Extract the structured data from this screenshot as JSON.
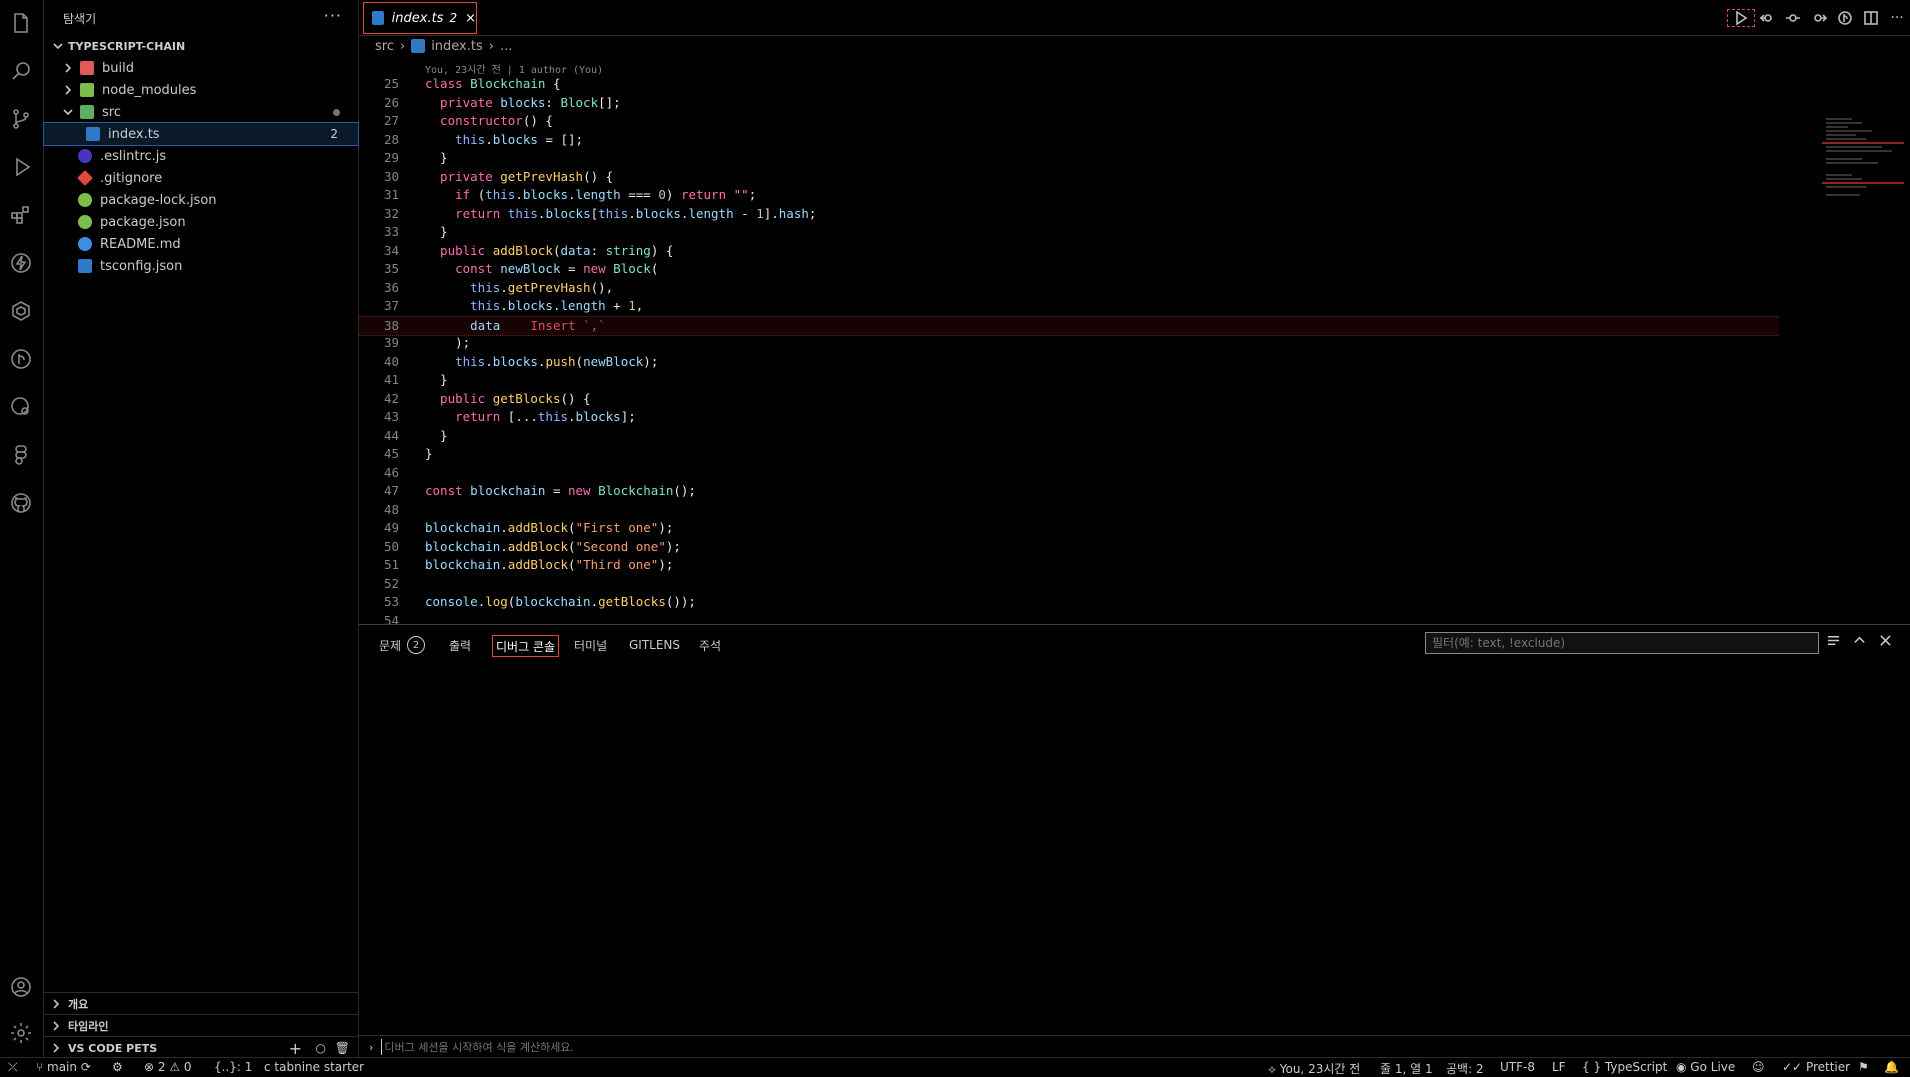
{
  "sidebar": {
    "title": "탐색기",
    "more": "···",
    "project": "TYPESCRIPT-CHAIN",
    "items": [
      {
        "label": "build",
        "type": "folder",
        "icon": "folder-build-icon",
        "color": "#e05a5a"
      },
      {
        "label": "node_modules",
        "type": "folder",
        "icon": "folder-node-icon",
        "color": "#7bbf4a"
      },
      {
        "label": "src",
        "type": "folder-open",
        "icon": "folder-src-icon",
        "color": "#5fae5f"
      },
      {
        "label": "index.ts",
        "type": "file",
        "icon": "typescript-file-icon",
        "color": "#3178c6",
        "badge": "2"
      },
      {
        "label": ".eslintrc.js",
        "type": "file",
        "icon": "eslint-icon",
        "color": "#4b32c3"
      },
      {
        "label": ".gitignore",
        "type": "file",
        "icon": "git-icon",
        "color": "#e0483a"
      },
      {
        "label": "package-lock.json",
        "type": "file",
        "icon": "npm-icon",
        "color": "#7bbf4a"
      },
      {
        "label": "package.json",
        "type": "file",
        "icon": "npm-icon",
        "color": "#7bbf4a"
      },
      {
        "label": "README.md",
        "type": "file",
        "icon": "info-icon",
        "color": "#3b8fe0"
      },
      {
        "label": "tsconfig.json",
        "type": "file",
        "icon": "tsconfig-icon",
        "color": "#3178c6"
      }
    ],
    "sections": [
      "개요",
      "타임라인",
      "VS CODE PETS"
    ]
  },
  "tab": {
    "label": "index.ts",
    "badge": "2",
    "close": "×"
  },
  "breadcrumb": {
    "folder": "src",
    "file": "index.ts",
    "more": "..."
  },
  "blame": "You, 23시간 전 | 1 author (You)",
  "panel": {
    "tabs": [
      "문제",
      "출력",
      "디버그 콘솔",
      "터미널",
      "GITLENS",
      "주석"
    ],
    "problems_count": "2",
    "filter_placeholder": "필터(예: text, !exclude)",
    "console_placeholder": "디버그 세션을 시작하여 식을 계산하세요."
  },
  "status": {
    "branch": "main",
    "errors": "2",
    "warnings": "0",
    "tabnine": "tabnine starter",
    "json": "{..}: 1",
    "blame": "You, 23시간 전",
    "position": "줄 1, 열 1",
    "spaces": "공백: 2",
    "encoding": "UTF-8",
    "eol": "LF",
    "language": "TypeScript",
    "golive": "Go Live",
    "prettier": "Prettier"
  },
  "code": {
    "lines": [
      {
        "n": "25",
        "t": [
          [
            "kw",
            "class "
          ],
          [
            "cls",
            "Blockchain"
          ],
          [
            "plain",
            " {"
          ]
        ]
      },
      {
        "n": "26",
        "t": [
          [
            "kw",
            "  private "
          ],
          [
            "prop",
            "blocks"
          ],
          [
            "plain",
            ": "
          ],
          [
            "cls",
            "Block"
          ],
          [
            "plain",
            "[];"
          ]
        ]
      },
      {
        "n": "27",
        "t": [
          [
            "kw",
            "  constructor"
          ],
          [
            "plain",
            "() {"
          ]
        ]
      },
      {
        "n": "28",
        "t": [
          [
            "this",
            "    this"
          ],
          [
            "plain",
            "."
          ],
          [
            "prop",
            "blocks"
          ],
          [
            "plain",
            " = [];"
          ]
        ]
      },
      {
        "n": "29",
        "t": [
          [
            "plain",
            "  }"
          ]
        ]
      },
      {
        "n": "30",
        "t": [
          [
            "kw",
            "  private "
          ],
          [
            "fn",
            "getPrevHash"
          ],
          [
            "plain",
            "() {"
          ]
        ]
      },
      {
        "n": "31",
        "t": [
          [
            "kw",
            "    if "
          ],
          [
            "plain",
            "("
          ],
          [
            "this",
            "this"
          ],
          [
            "plain",
            "."
          ],
          [
            "prop",
            "blocks"
          ],
          [
            "plain",
            "."
          ],
          [
            "prop",
            "length"
          ],
          [
            "plain",
            " === "
          ],
          [
            "num",
            "0"
          ],
          [
            "plain",
            ") "
          ],
          [
            "kw",
            "return "
          ],
          [
            "str",
            "\"\""
          ],
          [
            "plain",
            ";"
          ]
        ]
      },
      {
        "n": "32",
        "t": [
          [
            "kw",
            "    return "
          ],
          [
            "this",
            "this"
          ],
          [
            "plain",
            "."
          ],
          [
            "prop",
            "blocks"
          ],
          [
            "plain",
            "["
          ],
          [
            "this",
            "this"
          ],
          [
            "plain",
            "."
          ],
          [
            "prop",
            "blocks"
          ],
          [
            "plain",
            "."
          ],
          [
            "prop",
            "length"
          ],
          [
            "plain",
            " - "
          ],
          [
            "num",
            "1"
          ],
          [
            "plain",
            "]."
          ],
          [
            "prop",
            "hash"
          ],
          [
            "plain",
            ";"
          ]
        ]
      },
      {
        "n": "33",
        "t": [
          [
            "plain",
            "  }"
          ]
        ]
      },
      {
        "n": "34",
        "t": [
          [
            "kw",
            "  public "
          ],
          [
            "fn",
            "addBlock"
          ],
          [
            "plain",
            "("
          ],
          [
            "prop",
            "data"
          ],
          [
            "plain",
            ": "
          ],
          [
            "cls",
            "string"
          ],
          [
            "plain",
            ") {"
          ]
        ]
      },
      {
        "n": "35",
        "t": [
          [
            "kw",
            "    const "
          ],
          [
            "prop",
            "newBlock"
          ],
          [
            "plain",
            " = "
          ],
          [
            "kw",
            "new "
          ],
          [
            "cls",
            "Block"
          ],
          [
            "plain",
            "("
          ]
        ]
      },
      {
        "n": "36",
        "t": [
          [
            "this",
            "      this"
          ],
          [
            "plain",
            "."
          ],
          [
            "fn",
            "getPrevHash"
          ],
          [
            "plain",
            "(),"
          ]
        ]
      },
      {
        "n": "37",
        "t": [
          [
            "this",
            "      this"
          ],
          [
            "plain",
            "."
          ],
          [
            "prop",
            "blocks"
          ],
          [
            "plain",
            "."
          ],
          [
            "prop",
            "length"
          ],
          [
            "plain",
            " + "
          ],
          [
            "num",
            "1"
          ],
          [
            "plain",
            ","
          ]
        ]
      },
      {
        "n": "38",
        "t": [
          [
            "prop",
            "      data"
          ],
          [
            "hint",
            "    Insert `,`"
          ]
        ],
        "error": true
      },
      {
        "n": "39",
        "t": [
          [
            "plain",
            "    );"
          ]
        ]
      },
      {
        "n": "40",
        "t": [
          [
            "this",
            "    this"
          ],
          [
            "plain",
            "."
          ],
          [
            "prop",
            "blocks"
          ],
          [
            "plain",
            "."
          ],
          [
            "fn",
            "push"
          ],
          [
            "plain",
            "("
          ],
          [
            "prop",
            "newBlock"
          ],
          [
            "plain",
            ");"
          ]
        ]
      },
      {
        "n": "41",
        "t": [
          [
            "plain",
            "  }"
          ]
        ]
      },
      {
        "n": "42",
        "t": [
          [
            "kw",
            "  public "
          ],
          [
            "fn",
            "getBlocks"
          ],
          [
            "plain",
            "() {"
          ]
        ]
      },
      {
        "n": "43",
        "t": [
          [
            "kw",
            "    return "
          ],
          [
            "plain",
            "[..."
          ],
          [
            "this",
            "this"
          ],
          [
            "plain",
            "."
          ],
          [
            "prop",
            "blocks"
          ],
          [
            "plain",
            "];"
          ]
        ]
      },
      {
        "n": "44",
        "t": [
          [
            "plain",
            "  }"
          ]
        ]
      },
      {
        "n": "45",
        "t": [
          [
            "plain",
            "}"
          ]
        ]
      },
      {
        "n": "46",
        "t": []
      },
      {
        "n": "47",
        "t": [
          [
            "kw",
            "const "
          ],
          [
            "prop",
            "blockchain"
          ],
          [
            "plain",
            " = "
          ],
          [
            "kw",
            "new "
          ],
          [
            "cls",
            "Blockchain"
          ],
          [
            "plain",
            "();"
          ]
        ]
      },
      {
        "n": "48",
        "t": []
      },
      {
        "n": "49",
        "t": [
          [
            "prop",
            "blockchain"
          ],
          [
            "plain",
            "."
          ],
          [
            "fn",
            "addBlock"
          ],
          [
            "plain",
            "("
          ],
          [
            "str",
            "\"First one\""
          ],
          [
            "plain",
            ");"
          ]
        ]
      },
      {
        "n": "50",
        "t": [
          [
            "prop",
            "blockchain"
          ],
          [
            "plain",
            "."
          ],
          [
            "fn",
            "addBlock"
          ],
          [
            "plain",
            "("
          ],
          [
            "str",
            "\"Second one\""
          ],
          [
            "plain",
            ");"
          ]
        ]
      },
      {
        "n": "51",
        "t": [
          [
            "prop",
            "blockchain"
          ],
          [
            "plain",
            "."
          ],
          [
            "fn",
            "addBlock"
          ],
          [
            "plain",
            "("
          ],
          [
            "str",
            "\"Third one\""
          ],
          [
            "plain",
            ");"
          ]
        ]
      },
      {
        "n": "52",
        "t": []
      },
      {
        "n": "53",
        "t": [
          [
            "prop",
            "console"
          ],
          [
            "plain",
            "."
          ],
          [
            "fn",
            "log"
          ],
          [
            "plain",
            "("
          ],
          [
            "prop",
            "blockchain"
          ],
          [
            "plain",
            "."
          ],
          [
            "fn",
            "getBlocks"
          ],
          [
            "plain",
            "());"
          ]
        ]
      },
      {
        "n": "54",
        "t": []
      }
    ]
  }
}
